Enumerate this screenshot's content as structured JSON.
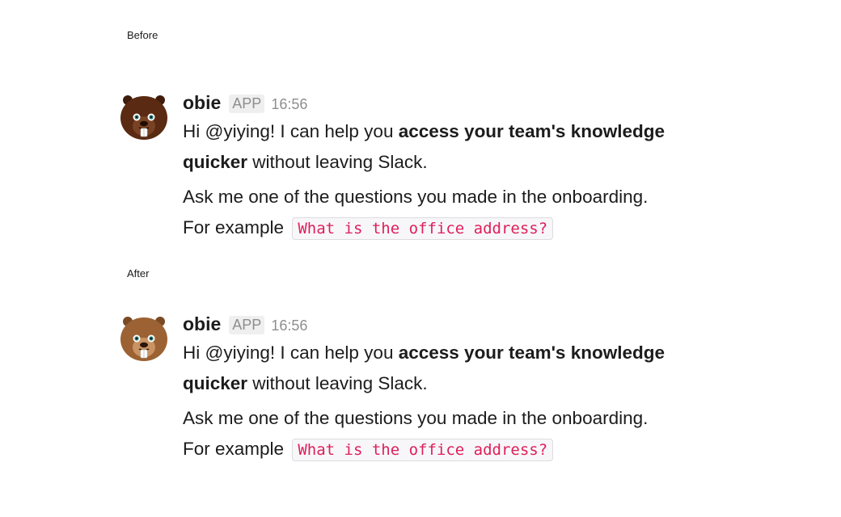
{
  "before": {
    "label": "Before",
    "message": {
      "sender": "obie",
      "badge": "APP",
      "time": "16:56",
      "line1_prefix": "Hi @yiying! I can help you ",
      "line1_bold": "access your team's knowledge quicker",
      "line1_suffix": " without leaving Slack.",
      "line2": "Ask me one of the questions you made in the onboarding.",
      "line3_prefix": "For example",
      "code": "What is the office address?"
    },
    "avatar_color": "#5a2a12"
  },
  "after": {
    "label": "After",
    "message": {
      "sender": "obie",
      "badge": "APP",
      "time": "16:56",
      "line1_prefix": "Hi @yiying! I can help you ",
      "line1_bold": "access your team's knowledge quicker",
      "line1_suffix": " without leaving Slack.",
      "line2": "Ask me one of the questions you made in the onboarding.",
      "line3_prefix": "For example",
      "code": "What is the office address?"
    },
    "avatar_color": "#9c6233"
  },
  "colors": {
    "code_text": "#e01e5a",
    "muted": "#8e8e8e"
  }
}
